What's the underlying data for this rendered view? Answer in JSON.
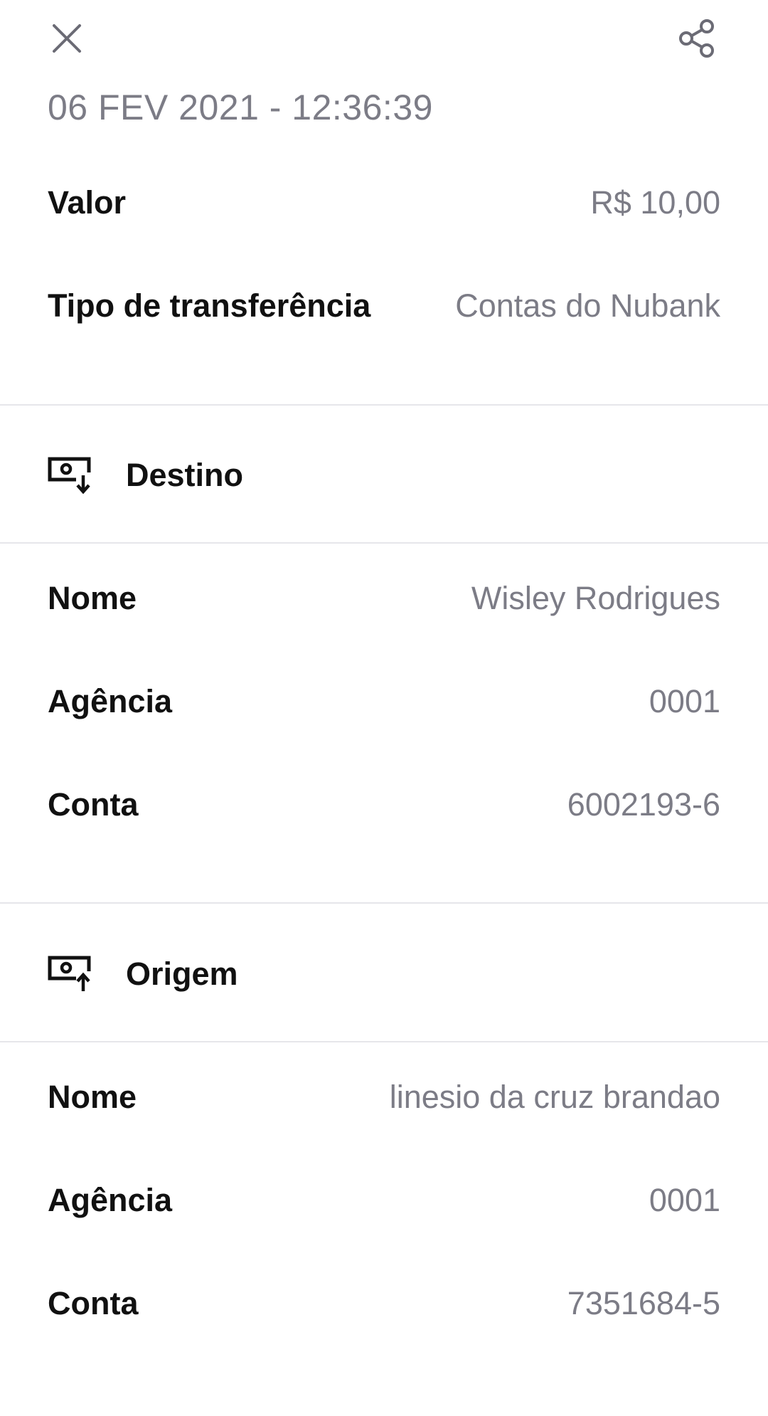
{
  "header": {
    "close_icon": "close-icon",
    "share_icon": "share-icon",
    "timestamp": "06 FEV 2021 - 12:36:39"
  },
  "summary": {
    "rows": [
      {
        "label": "Valor",
        "value": "R$ 10,00"
      },
      {
        "label": "Tipo de transferência",
        "value": "Contas do Nubank"
      }
    ]
  },
  "destino": {
    "icon": "money-receive-icon",
    "title": "Destino",
    "rows": [
      {
        "label": "Nome",
        "value": "Wisley Rodrigues"
      },
      {
        "label": "Agência",
        "value": "0001"
      },
      {
        "label": "Conta",
        "value": "6002193-6"
      }
    ]
  },
  "origem": {
    "icon": "money-send-icon",
    "title": "Origem",
    "rows": [
      {
        "label": "Nome",
        "value": "linesio da cruz brandao"
      },
      {
        "label": "Agência",
        "value": "0001"
      },
      {
        "label": "Conta",
        "value": "7351684-5"
      }
    ]
  },
  "colors": {
    "text_primary": "#111111",
    "text_secondary": "#7c7c86",
    "divider": "#e6e6ea",
    "icon": "#6b6b75"
  }
}
